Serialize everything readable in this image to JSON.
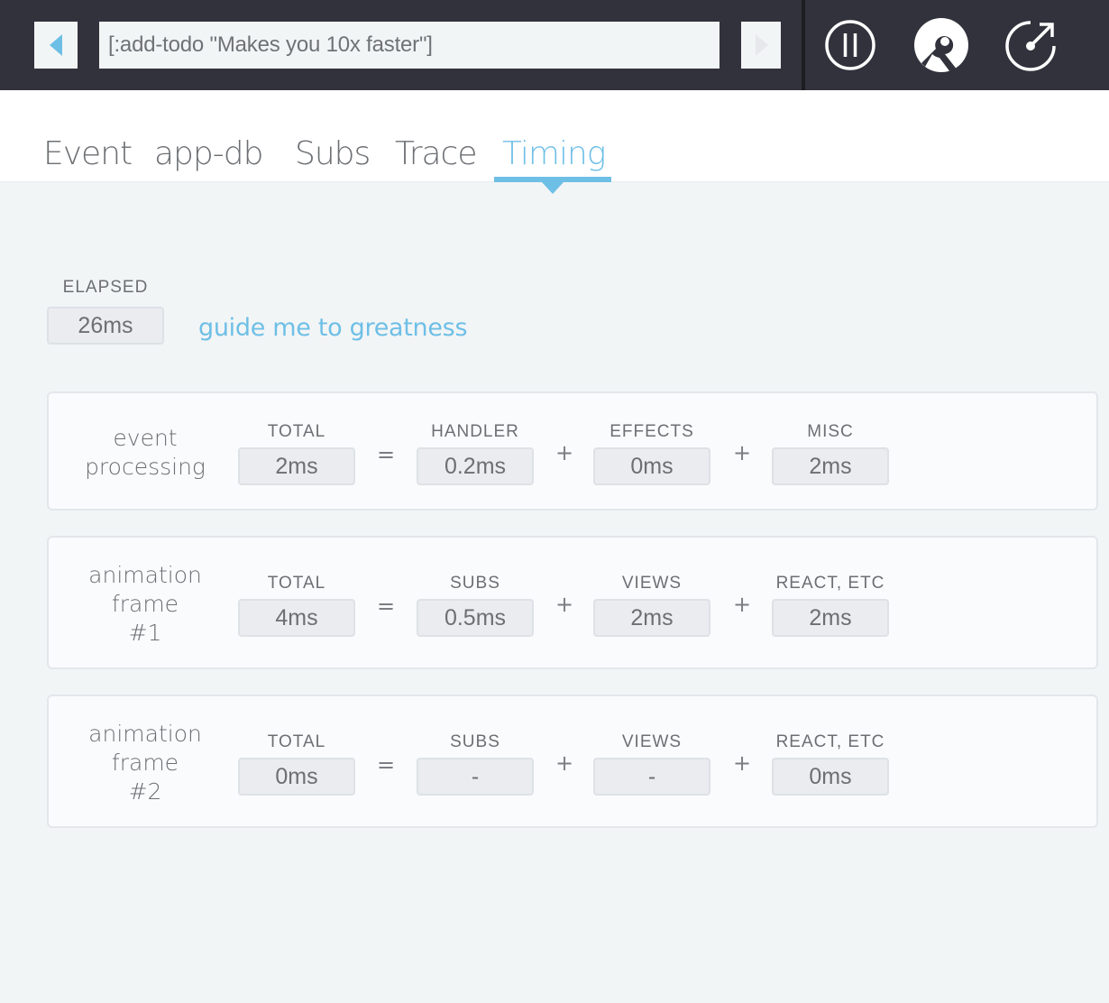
{
  "topbar": {
    "prev_icon": "triangle-left-icon",
    "next_icon": "triangle-right-icon",
    "event_text": "[:add-todo \"Makes you 10x faster\"]",
    "icons": [
      "pause-icon",
      "settings-wrench-icon",
      "popout-icon"
    ],
    "accent_color": "#6ebfe6",
    "background_color": "#32323c"
  },
  "tabs": [
    {
      "label": "Event",
      "active": false
    },
    {
      "label": "app-db",
      "active": false
    },
    {
      "label": "Subs",
      "active": false
    },
    {
      "label": "Trace",
      "active": false
    },
    {
      "label": "Timing",
      "active": true
    }
  ],
  "elapsed": {
    "label": "ELAPSED",
    "value": "26ms",
    "link_text": "guide me to greatness"
  },
  "panels": [
    {
      "title": [
        "event",
        "processing"
      ],
      "cells": [
        {
          "label": "TOTAL",
          "value": "2ms"
        },
        {
          "label": "HANDLER",
          "value": "0.2ms"
        },
        {
          "label": "EFFECTS",
          "value": "0ms"
        },
        {
          "label": "MISC",
          "value": "2ms"
        }
      ],
      "ops": [
        "=",
        "+",
        "+"
      ]
    },
    {
      "title": [
        "animation",
        "frame",
        "#1"
      ],
      "cells": [
        {
          "label": "TOTAL",
          "value": "4ms"
        },
        {
          "label": "SUBS",
          "value": "0.5ms"
        },
        {
          "label": "VIEWS",
          "value": "2ms"
        },
        {
          "label": "REACT, ETC",
          "value": "2ms"
        }
      ],
      "ops": [
        "=",
        "+",
        "+"
      ]
    },
    {
      "title": [
        "animation",
        "frame",
        "#2"
      ],
      "cells": [
        {
          "label": "TOTAL",
          "value": "0ms"
        },
        {
          "label": "SUBS",
          "value": "-"
        },
        {
          "label": "VIEWS",
          "value": "-"
        },
        {
          "label": "REACT, ETC",
          "value": "0ms"
        }
      ],
      "ops": [
        "=",
        "+",
        "+"
      ]
    }
  ]
}
